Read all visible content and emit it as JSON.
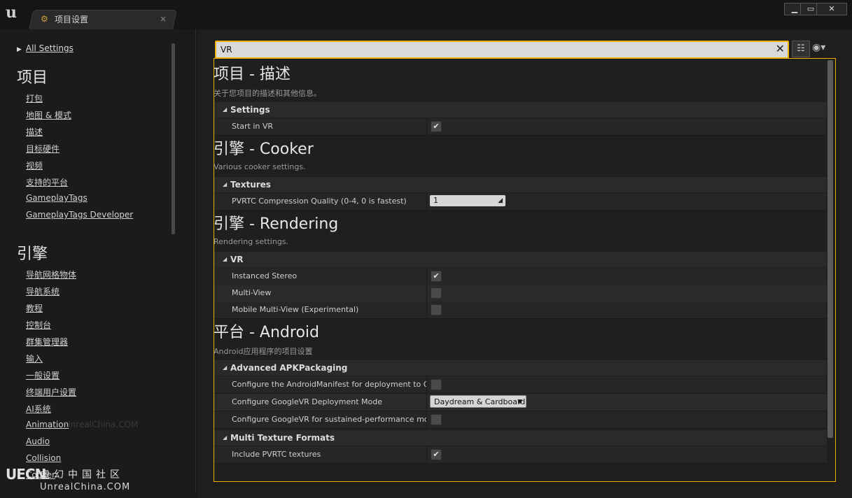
{
  "window": {
    "tab_label": "项目设置",
    "tab_close": "×",
    "minimize": "▁",
    "maximize": "▭",
    "close": "✕"
  },
  "sidebar": {
    "all_settings": "All Settings",
    "sections": [
      {
        "title": "项目",
        "items": [
          "打包",
          "地图 & 模式",
          "描述",
          "目标硬件",
          "视频",
          "支持的平台",
          "GameplayTags",
          "GameplayTags Developer"
        ]
      },
      {
        "title": "引擎",
        "items": [
          "导航网格物体",
          "导航系统",
          "教程",
          "控制台",
          "群集管理器",
          "输入",
          "一般设置",
          "终端用户设置",
          "AI系统",
          "Animation",
          "Audio",
          "Collision",
          "Cooker"
        ]
      }
    ]
  },
  "search": {
    "value": "VR",
    "placeholder": ""
  },
  "content": {
    "sections": [
      {
        "title": "项目 - 描述",
        "description": "关于您项目的描述和其他信息。",
        "categories": [
          {
            "name": "Settings",
            "rows": [
              {
                "label": "Start in VR",
                "type": "checkbox",
                "checked": true
              }
            ]
          }
        ]
      },
      {
        "title": "引擎 - Cooker",
        "description": "Various cooker settings.",
        "categories": [
          {
            "name": "Textures",
            "rows": [
              {
                "label": "PVRTC Compression Quality (0-4, 0 is fastest)",
                "type": "number",
                "value": "1"
              }
            ]
          }
        ]
      },
      {
        "title": "引擎 - Rendering",
        "description": "Rendering settings.",
        "categories": [
          {
            "name": "VR",
            "rows": [
              {
                "label": "Instanced Stereo",
                "type": "checkbox",
                "checked": true
              },
              {
                "label": "Multi-View",
                "type": "checkbox",
                "checked": false
              },
              {
                "label": "Mobile Multi-View (Experimental)",
                "type": "checkbox",
                "checked": false
              }
            ]
          }
        ]
      },
      {
        "title": "平台 - Android",
        "description": "Android应用程序的项目设置",
        "categories": [
          {
            "name": "Advanced APKPackaging",
            "rows": [
              {
                "label": "Configure the AndroidManifest for deployment to GearVR",
                "type": "checkbox",
                "checked": false
              },
              {
                "label": "Configure GoogleVR Deployment Mode",
                "type": "dropdown",
                "value": "Daydream & Cardboard"
              },
              {
                "label": "Configure GoogleVR for sustained-performance mode",
                "type": "checkbox",
                "checked": false
              }
            ]
          },
          {
            "name": "Multi Texture Formats",
            "rows": [
              {
                "label": "Include PVRTC textures",
                "type": "checkbox",
                "checked": true
              }
            ]
          }
        ]
      }
    ]
  },
  "watermark": {
    "logo": "UECN",
    "cn": "虚幻中国社区",
    "en": "UnrealChina.COM",
    "faint": "UnrealChina.COM"
  },
  "icons": {
    "ue_logo": "unreal-logo-icon",
    "tab": "settings-gear-icon",
    "clear": "close-icon",
    "view": "view-options-icon",
    "eye": "eye-icon",
    "expand": "triangle-right-icon",
    "collapse": "triangle-down-icon"
  },
  "colors": {
    "accent": "#f0b000",
    "background": "#1e1e1e"
  }
}
